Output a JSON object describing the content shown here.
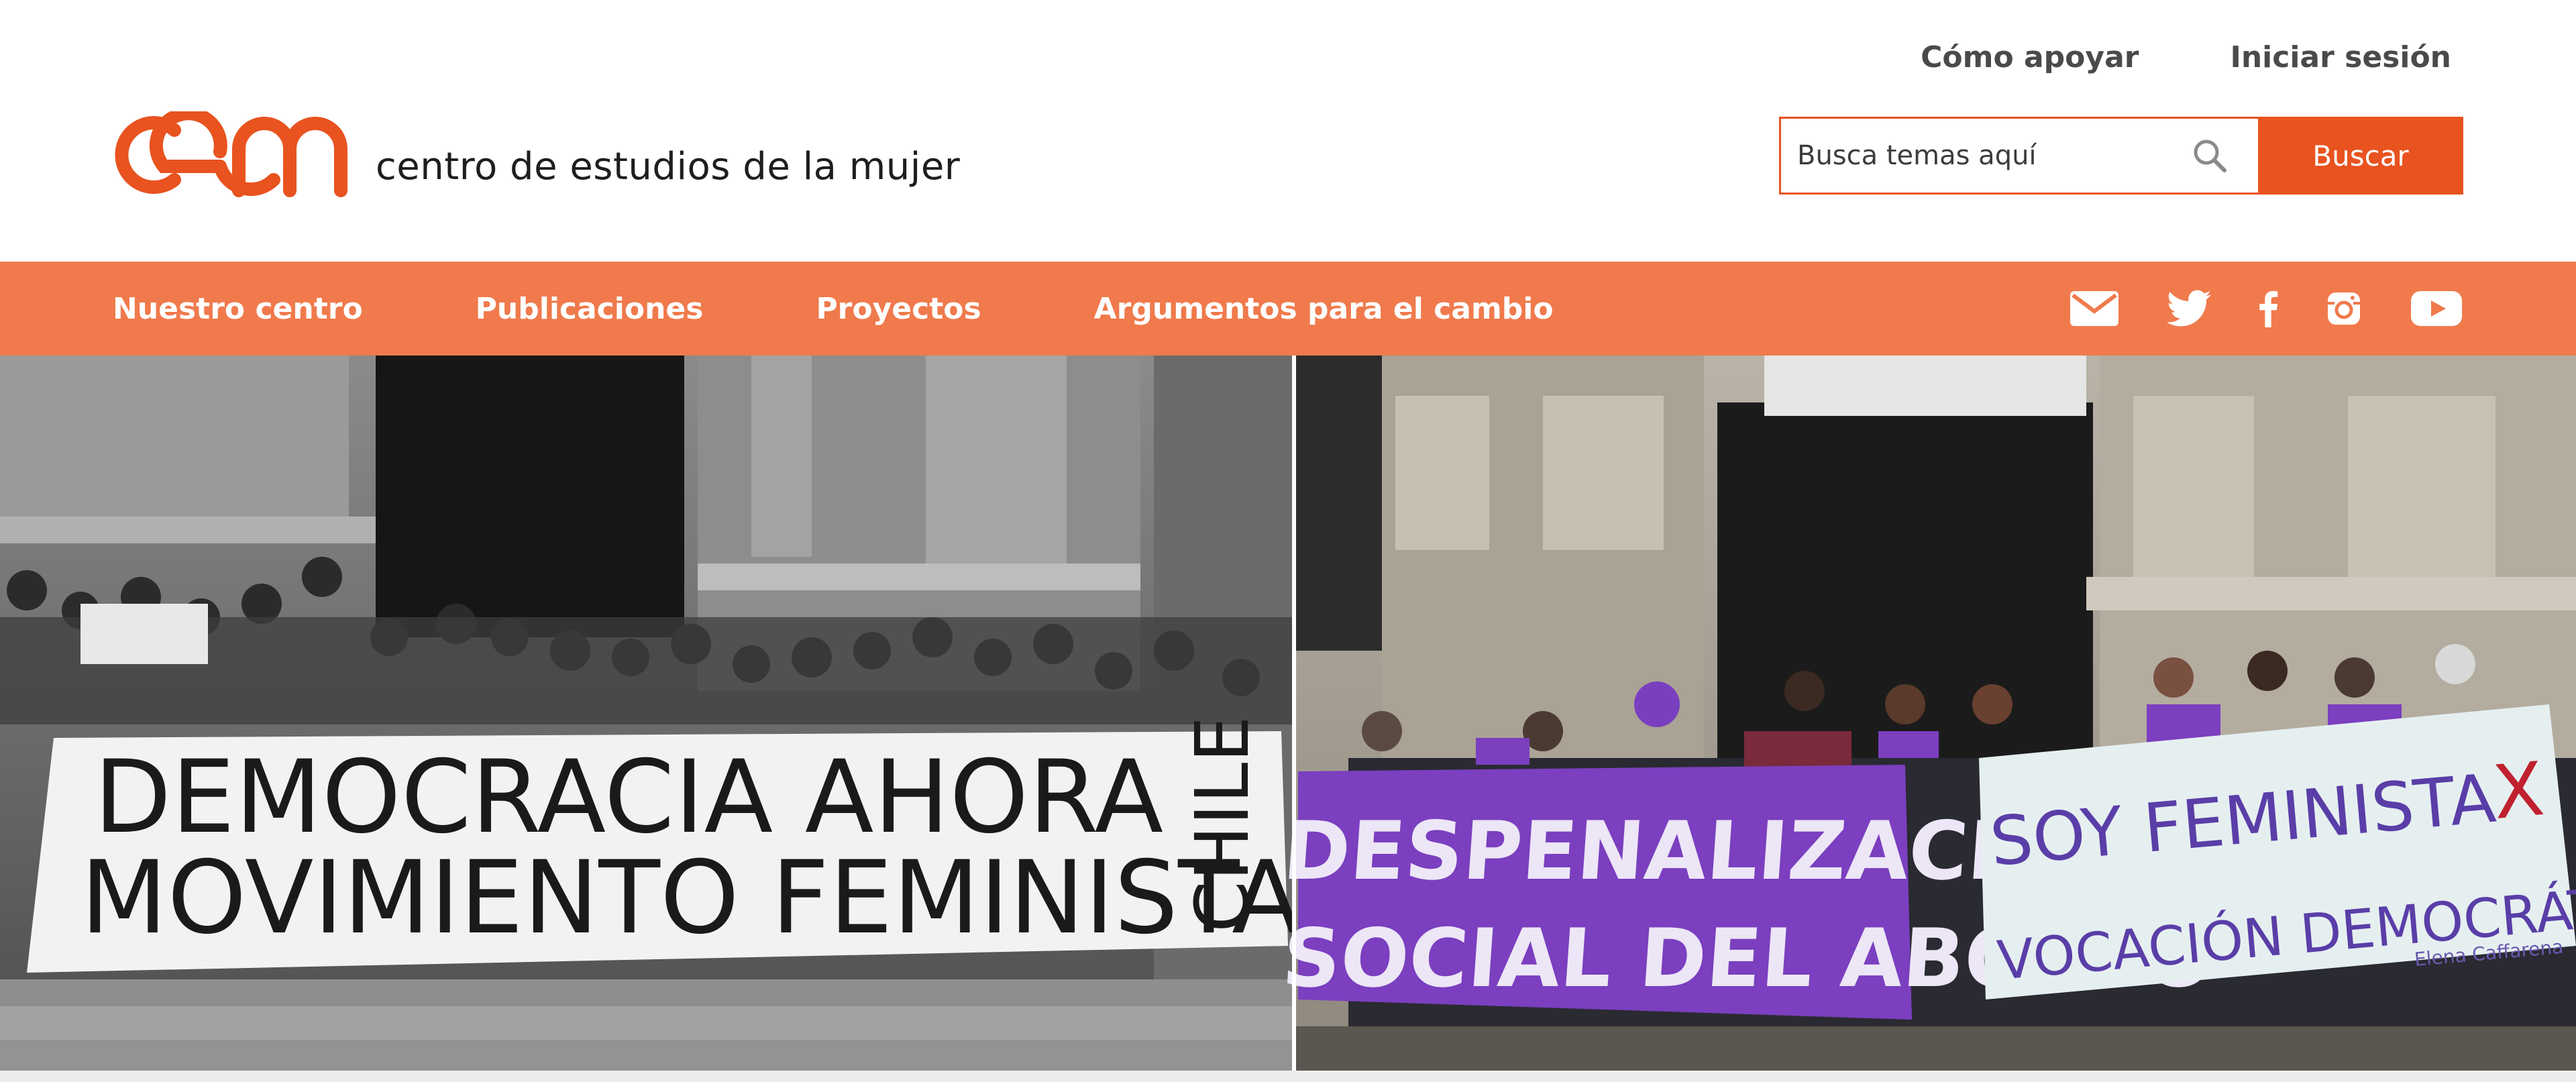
{
  "header": {
    "top_links": [
      {
        "label": "Cómo apoyar"
      },
      {
        "label": "Iniciar sesión"
      }
    ],
    "logo": {
      "mark": "cem",
      "text": "centro de estudios de la mujer"
    },
    "search": {
      "placeholder": "Busca temas aquí",
      "button_label": "Buscar",
      "icon": "search-icon"
    }
  },
  "nav": {
    "items": [
      {
        "label": "Nuestro centro"
      },
      {
        "label": "Publicaciones"
      },
      {
        "label": "Proyectos"
      },
      {
        "label": "Argumentos para el cambio"
      }
    ],
    "social_icons": [
      "mail-icon",
      "twitter-icon",
      "facebook-icon",
      "instagram-icon",
      "youtube-icon"
    ]
  },
  "hero": {
    "left_banner": {
      "line1": "DEMOCRACIA AHORA",
      "line2": "MOVIMIENTO FEMINISTA",
      "side": "CHILE"
    },
    "center_banner": {
      "line1": "DESPENALIZACION",
      "line2": "SOCIAL DEL ABORTO"
    },
    "right_banner": {
      "line1": "SOY FEMINISTA",
      "mark": "X",
      "line2": "VOCACIÓN DEMOCRÁTICA",
      "signature": "Elena Caffarena"
    }
  },
  "colors": {
    "brand_orange": "#e8531f",
    "nav_orange": "#f07a4c",
    "purple": "#7b3fbf"
  }
}
